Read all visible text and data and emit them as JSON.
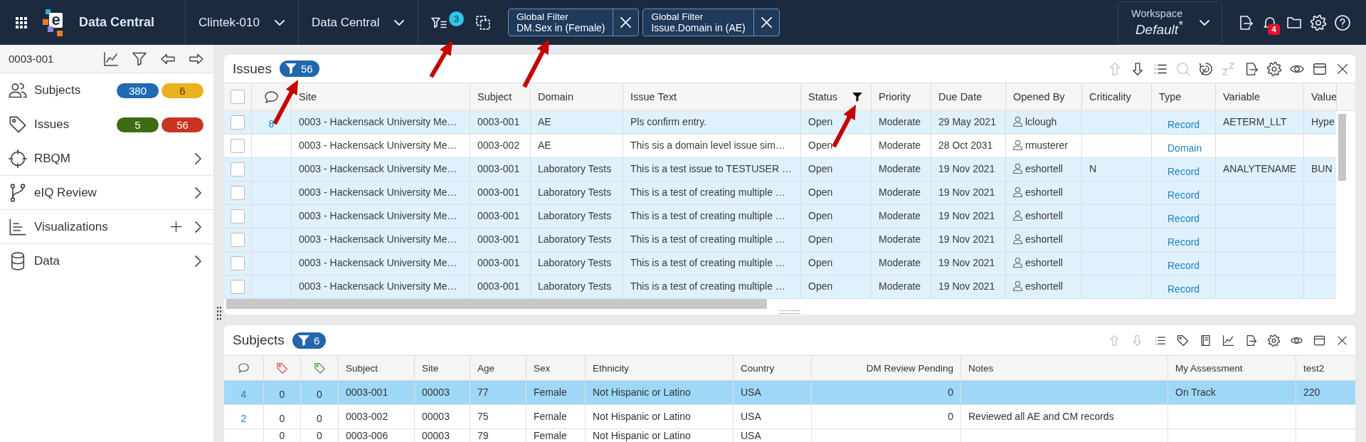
{
  "top_bar": {
    "logo_letter": "e",
    "app_title": "Data Central",
    "selectors": [
      {
        "label": "Clintek-010"
      },
      {
        "label": "Data Central"
      }
    ],
    "filter_count": "3",
    "global_filters": [
      {
        "title": "Global Filter",
        "condition": "DM.Sex in (Female)"
      },
      {
        "title": "Global Filter",
        "condition": "Issue.Domain in (AE)"
      }
    ],
    "workspace": {
      "label": "Workspace",
      "name": "Default$^{*}$"
    },
    "notification_count": "4"
  },
  "sidebar": {
    "subject": "0003-001",
    "items": [
      {
        "label": "Subjects",
        "badges": [
          {
            "text": "380",
            "color": "#1f6bb0"
          },
          {
            "text": "6",
            "color": "#ecb023"
          }
        ],
        "expandable": false,
        "addable": false
      },
      {
        "label": "Issues",
        "badges": [
          {
            "text": "5",
            "color": "#3e6c12"
          },
          {
            "text": "56",
            "color": "#c93422"
          }
        ],
        "expandable": false,
        "addable": false
      },
      {
        "label": "RBQM",
        "expandable": true,
        "addable": false
      },
      {
        "label": "eIQ Review",
        "expandable": true,
        "addable": false
      },
      {
        "label": "Visualizations",
        "expandable": true,
        "addable": true
      },
      {
        "label": "Data",
        "expandable": true,
        "addable": false
      }
    ]
  },
  "issues": {
    "title": "Issues",
    "filter_count": "56",
    "tools": [
      {
        "kind": "move-up",
        "disabled": true
      },
      {
        "kind": "move-down",
        "disabled": false
      },
      {
        "kind": "list",
        "disabled": false
      },
      {
        "kind": "search",
        "disabled": true
      },
      {
        "kind": "swirl",
        "disabled": false
      },
      {
        "kind": "snooze",
        "disabled": true
      },
      {
        "kind": "export",
        "disabled": false
      },
      {
        "kind": "settings",
        "disabled": false
      },
      {
        "kind": "view",
        "disabled": false
      },
      {
        "kind": "layout",
        "disabled": false
      },
      {
        "kind": "close",
        "disabled": false
      }
    ],
    "select_all": {
      "checked": false
    },
    "columns": [
      {
        "kind": "comment"
      },
      {
        "kind": "text",
        "label": "Site",
        "filtered": false
      },
      {
        "kind": "text",
        "label": "Subject",
        "filtered": false
      },
      {
        "kind": "text",
        "label": "Domain",
        "filtered": false
      },
      {
        "kind": "text",
        "label": "Issue Text",
        "filtered": false
      },
      {
        "kind": "text",
        "label": "Status",
        "filtered": true
      },
      {
        "kind": "text",
        "label": "Priority",
        "filtered": false
      },
      {
        "kind": "text",
        "label": "Due Date",
        "filtered": false
      },
      {
        "kind": "user",
        "label": "Opened By",
        "filtered": false
      },
      {
        "kind": "text",
        "label": "Criticality",
        "filtered": false
      },
      {
        "kind": "link",
        "label": "Type",
        "filtered": false
      },
      {
        "kind": "text",
        "label": "Variable",
        "filtered": false
      },
      {
        "kind": "text",
        "label": "Value",
        "filtered": false
      }
    ],
    "rows": [
      {
        "checked": false,
        "highlighted": true,
        "cells": [
          "8",
          "0003 - Hackensack University Me…",
          "0003-001",
          "AE",
          "Pls confirm entry.",
          "Open",
          "Moderate",
          "29 May 2021",
          "lclough",
          null,
          "Record",
          "AETERM_LLT",
          "Hype"
        ]
      },
      {
        "checked": false,
        "highlighted": false,
        "cells": [
          null,
          "0003 - Hackensack University Me…",
          "0003-002",
          "AE",
          "This sis a domain level issue sim…",
          "Open",
          "Moderate",
          "28 Oct 2031",
          "rmusterer",
          null,
          "Domain",
          null,
          null
        ]
      },
      {
        "checked": false,
        "highlighted": true,
        "cells": [
          null,
          "0003 - Hackensack University Me…",
          "0003-001",
          "Laboratory Tests",
          "This is a test issue to TESTUSER …",
          "Open",
          "Moderate",
          "19 Nov 2021",
          "eshortell",
          "N",
          "Record",
          "ANALYTENAME",
          "BUN"
        ]
      },
      {
        "checked": false,
        "highlighted": true,
        "cells": [
          null,
          "0003 - Hackensack University Me…",
          "0003-001",
          "Laboratory Tests",
          "This is a test of creating multiple …",
          "Open",
          "Moderate",
          "19 Nov 2021",
          "eshortell",
          null,
          "Record",
          null,
          null
        ]
      },
      {
        "checked": false,
        "highlighted": true,
        "cells": [
          null,
          "0003 - Hackensack University Me…",
          "0003-001",
          "Laboratory Tests",
          "This is a test of creating multiple …",
          "Open",
          "Moderate",
          "19 Nov 2021",
          "eshortell",
          null,
          "Record",
          null,
          null
        ]
      },
      {
        "checked": false,
        "highlighted": true,
        "cells": [
          null,
          "0003 - Hackensack University Me…",
          "0003-001",
          "Laboratory Tests",
          "This is a test of creating multiple …",
          "Open",
          "Moderate",
          "19 Nov 2021",
          "eshortell",
          null,
          "Record",
          null,
          null
        ]
      },
      {
        "checked": false,
        "highlighted": true,
        "cells": [
          null,
          "0003 - Hackensack University Me…",
          "0003-001",
          "Laboratory Tests",
          "This is a test of creating multiple …",
          "Open",
          "Moderate",
          "19 Nov 2021",
          "eshortell",
          null,
          "Record",
          null,
          null
        ]
      },
      {
        "checked": false,
        "highlighted": true,
        "cells": [
          null,
          "0003 - Hackensack University Me…",
          "0003-001",
          "Laboratory Tests",
          "This is a test of creating multiple …",
          "Open",
          "Moderate",
          "19 Nov 2021",
          "eshortell",
          null,
          "Record",
          null,
          null
        ]
      }
    ]
  },
  "subjects": {
    "title": "Subjects",
    "filter_count": "6",
    "tools": [
      {
        "kind": "move-up",
        "disabled": true
      },
      {
        "kind": "move-down",
        "disabled": true
      },
      {
        "kind": "list",
        "disabled": false
      },
      {
        "kind": "tag",
        "disabled": false
      },
      {
        "kind": "book",
        "disabled": false
      },
      {
        "kind": "chart",
        "disabled": false
      },
      {
        "kind": "export",
        "disabled": false
      },
      {
        "kind": "settings",
        "disabled": false
      },
      {
        "kind": "view",
        "disabled": false
      },
      {
        "kind": "layout",
        "disabled": false
      },
      {
        "kind": "close",
        "disabled": false
      }
    ],
    "columns": [
      {
        "kind": "comment"
      },
      {
        "kind": "tag",
        "color": "#e05a5a"
      },
      {
        "kind": "tag",
        "color": "#4ea64e"
      },
      {
        "kind": "text",
        "label": "Subject"
      },
      {
        "kind": "text",
        "label": "Site"
      },
      {
        "kind": "text",
        "label": "Age"
      },
      {
        "kind": "text",
        "label": "Sex"
      },
      {
        "kind": "text",
        "label": "Ethnicity"
      },
      {
        "kind": "text",
        "label": "Country"
      },
      {
        "kind": "count",
        "label": "DM Review Pending"
      },
      {
        "kind": "text",
        "label": "Notes"
      },
      {
        "kind": "text",
        "label": "My Assessment"
      },
      {
        "kind": "text",
        "label": "test2"
      }
    ],
    "rows": [
      {
        "selected": true,
        "cells": [
          "4",
          "0",
          "0",
          "0003-001",
          "00003",
          "77",
          "Female",
          "Not Hispanic or Latino",
          "USA",
          "0",
          null,
          "On Track",
          "220"
        ]
      },
      {
        "selected": false,
        "cells": [
          "2",
          "0",
          "0",
          "0003-002",
          "00003",
          "75",
          "Female",
          "Not Hispanic or Latino",
          "USA",
          "0",
          "Reviewed all AE and CM records",
          null,
          null
        ]
      },
      {
        "selected": false,
        "cells": [
          null,
          "0",
          "0",
          "0003-006",
          "00003",
          "79",
          "Female",
          "Not Hispanic or Latino",
          "USA",
          null,
          null,
          null,
          null
        ]
      }
    ]
  }
}
